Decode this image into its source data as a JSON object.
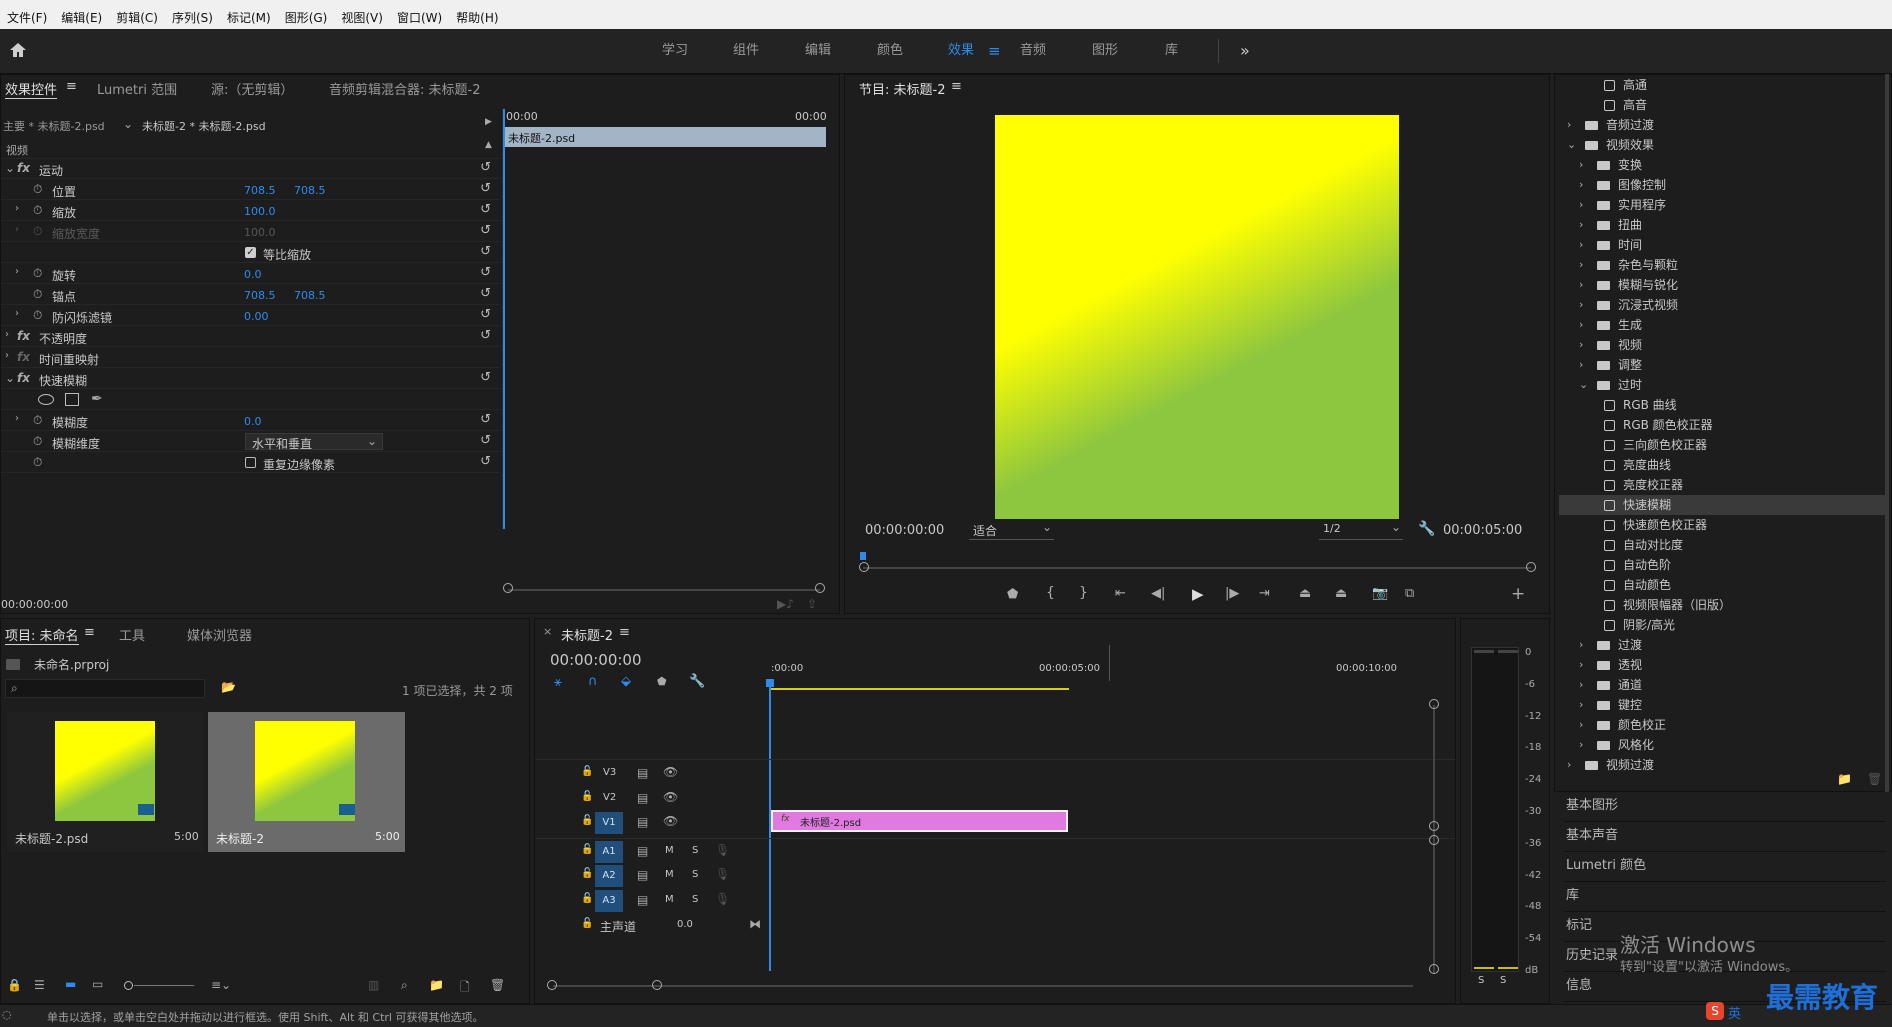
{
  "menu": [
    "文件(F)",
    "编辑(E)",
    "剪辑(C)",
    "序列(S)",
    "标记(M)",
    "图形(G)",
    "视图(V)",
    "窗口(W)",
    "帮助(H)"
  ],
  "workspaces": [
    "学习",
    "组件",
    "编辑",
    "颜色",
    "效果",
    "音频",
    "图形",
    "库"
  ],
  "workspace_active": "效果",
  "effect_controls": {
    "tabs": [
      "效果控件",
      "Lumetri 范围",
      "源:（无剪辑）",
      "音频剪辑混合器: 未标题-2"
    ],
    "master_label": "主要 * 未标题-2.psd",
    "sequence_label": "未标题-2 * 未标题-2.psd",
    "timecode_start": "00:00",
    "timecode_end": "00:00",
    "clip_name": "未标题-2.psd",
    "video_label": "视频",
    "rows": [
      {
        "name": "运动",
        "fx": true
      },
      {
        "name": "位置",
        "v1": "708.5",
        "v2": "708.5"
      },
      {
        "name": "缩放",
        "v1": "100.0"
      },
      {
        "name": "缩放宽度",
        "v1": "100.0",
        "disabled": true
      },
      {
        "name": "等比缩放",
        "checkbox": true
      },
      {
        "name": "旋转",
        "v1": "0.0"
      },
      {
        "name": "锚点",
        "v1": "708.5",
        "v2": "708.5"
      },
      {
        "name": "防闪烁滤镜",
        "v1": "0.00"
      },
      {
        "name": "不透明度",
        "fx": true
      },
      {
        "name": "时间重映射",
        "fx": true
      },
      {
        "name": "快速模糊",
        "fx": true
      },
      {
        "name": "模糊度",
        "v1": "0.0"
      },
      {
        "name": "模糊维度",
        "dropdown": "水平和垂直"
      },
      {
        "name": "重复边缘像素",
        "checkbox": true
      }
    ],
    "bottom_timecode": "00:00:00:00"
  },
  "program": {
    "title": "节目: 未标题-2",
    "timecode": "00:00:00:00",
    "fit": "适合",
    "resolution": "1/2",
    "duration": "00:00:05:00"
  },
  "effects_tree": [
    {
      "label": "高通",
      "kind": "fx",
      "level": 3
    },
    {
      "label": "高音",
      "kind": "fx",
      "level": 3
    },
    {
      "label": "音频过渡",
      "kind": "folder",
      "level": 1,
      "open": false
    },
    {
      "label": "视频效果",
      "kind": "folder",
      "level": 1,
      "open": true
    },
    {
      "label": "变换",
      "kind": "folder",
      "level": 2
    },
    {
      "label": "图像控制",
      "kind": "folder",
      "level": 2
    },
    {
      "label": "实用程序",
      "kind": "folder",
      "level": 2
    },
    {
      "label": "扭曲",
      "kind": "folder",
      "level": 2
    },
    {
      "label": "时间",
      "kind": "folder",
      "level": 2
    },
    {
      "label": "杂色与颗粒",
      "kind": "folder",
      "level": 2
    },
    {
      "label": "模糊与锐化",
      "kind": "folder",
      "level": 2
    },
    {
      "label": "沉浸式视频",
      "kind": "folder",
      "level": 2
    },
    {
      "label": "生成",
      "kind": "folder",
      "level": 2
    },
    {
      "label": "视频",
      "kind": "folder",
      "level": 2
    },
    {
      "label": "调整",
      "kind": "folder",
      "level": 2
    },
    {
      "label": "过时",
      "kind": "folder",
      "level": 2,
      "open": true
    },
    {
      "label": "RGB 曲线",
      "kind": "fx",
      "level": 3
    },
    {
      "label": "RGB 颜色校正器",
      "kind": "fx",
      "level": 3
    },
    {
      "label": "三向颜色校正器",
      "kind": "fx",
      "level": 3
    },
    {
      "label": "亮度曲线",
      "kind": "fx",
      "level": 3
    },
    {
      "label": "亮度校正器",
      "kind": "fx",
      "level": 3
    },
    {
      "label": "快速模糊",
      "kind": "fx",
      "level": 3,
      "selected": true
    },
    {
      "label": "快速颜色校正器",
      "kind": "fx",
      "level": 3
    },
    {
      "label": "自动对比度",
      "kind": "fx",
      "level": 3
    },
    {
      "label": "自动色阶",
      "kind": "fx",
      "level": 3
    },
    {
      "label": "自动颜色",
      "kind": "fx",
      "level": 3
    },
    {
      "label": "视频限幅器（旧版）",
      "kind": "fx",
      "level": 3
    },
    {
      "label": "阴影/高光",
      "kind": "fx",
      "level": 3
    },
    {
      "label": "过渡",
      "kind": "folder",
      "level": 2
    },
    {
      "label": "透视",
      "kind": "folder",
      "level": 2
    },
    {
      "label": "通道",
      "kind": "folder",
      "level": 2
    },
    {
      "label": "键控",
      "kind": "folder",
      "level": 2
    },
    {
      "label": "颜色校正",
      "kind": "folder",
      "level": 2
    },
    {
      "label": "风格化",
      "kind": "folder",
      "level": 2
    },
    {
      "label": "视频过渡",
      "kind": "folder",
      "level": 1
    }
  ],
  "side_panels": [
    "基本图形",
    "基本声音",
    "Lumetri 颜色",
    "库",
    "标记",
    "历史记录",
    "信息"
  ],
  "project": {
    "tabs": [
      "项目: 未命名",
      "工具",
      "媒体浏览器"
    ],
    "file": "未命名.prproj",
    "selection": "1 项已选择，共 2 项",
    "items": [
      {
        "name": "未标题-2.psd",
        "duration": "5:00"
      },
      {
        "name": "未标题-2",
        "duration": "5:00"
      }
    ]
  },
  "timeline": {
    "title": "未标题-2",
    "timecode": "00:00:00:00",
    "ruler": [
      ":00:00",
      "00:00:05:00",
      "00:00:10:00"
    ],
    "tracks_video": [
      "V3",
      "V2",
      "V1"
    ],
    "tracks_audio": [
      "A1",
      "A2",
      "A3"
    ],
    "master_label": "主声道",
    "master_value": "0.0",
    "clip_label": "未标题-2.psd",
    "clip_prefix": "fx",
    "m": "M",
    "s": "S",
    "v1_target": "V1"
  },
  "meter_ticks": [
    "0",
    "-6",
    "-12",
    "-18",
    "-24",
    "-30",
    "-36",
    "-42",
    "-48",
    "-54",
    "dB"
  ],
  "meter_solo": [
    "S",
    "S"
  ],
  "status": "单击以选择，或单击空白处并拖动以进行框选。使用 Shift、Alt 和 Ctrl 可获得其他选项。",
  "watermark": {
    "line1": "激活 Windows",
    "line2": "转到\"设置\"以激活 Windows。",
    "brand": "最需教育"
  },
  "ime": [
    "S",
    "英"
  ],
  "colors": {
    "accent": "#2d8ceb",
    "yellow": "#ffff00",
    "green": "#8dc63f",
    "clip": "#e07ae0"
  }
}
